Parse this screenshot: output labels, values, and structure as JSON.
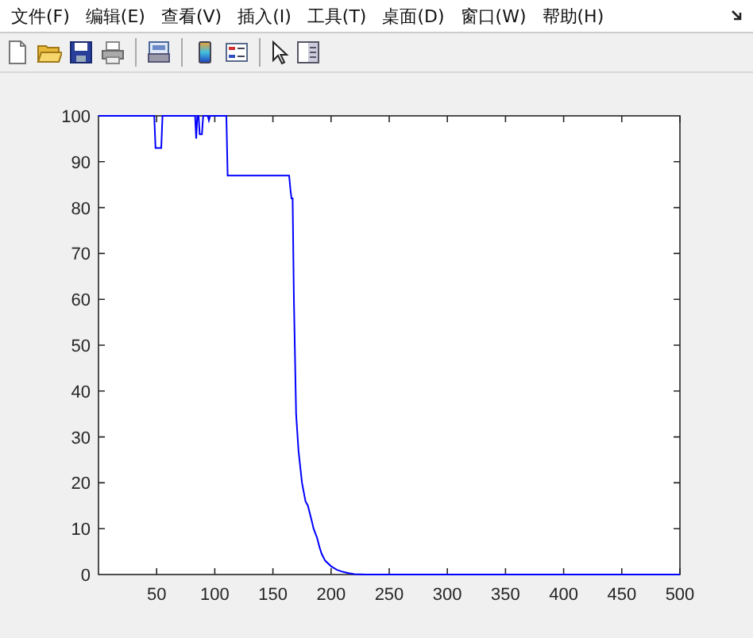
{
  "menu_bar": {
    "items": [
      "文件(F)",
      "编辑(E)",
      "查看(V)",
      "插入(I)",
      "工具(T)",
      "桌面(D)",
      "窗口(W)",
      "帮助(H)"
    ]
  },
  "figure": {
    "chart_data": {
      "type": "line",
      "x": [
        0,
        48,
        49,
        54,
        55,
        83,
        84,
        85,
        86,
        87,
        88,
        89,
        90,
        94,
        95,
        96,
        110,
        111,
        164,
        165,
        166,
        167,
        168,
        170,
        172,
        175,
        178,
        180,
        183,
        185,
        188,
        190,
        192,
        195,
        200,
        205,
        210,
        215,
        220,
        230,
        240,
        500
      ],
      "series": [
        {
          "color": "#0000ff",
          "values": [
            100,
            100,
            93,
            93,
            100,
            100,
            95,
            100,
            100,
            96,
            96,
            96,
            100,
            100,
            99,
            100,
            100,
            87,
            87,
            84,
            82,
            82,
            60,
            35,
            27,
            20,
            16,
            15,
            12,
            10,
            8,
            6,
            4.5,
            3,
            1.8,
            1,
            0.6,
            0.3,
            0.1,
            0,
            0,
            0
          ]
        }
      ],
      "xlim": [
        0,
        500
      ],
      "ylim": [
        0,
        100
      ],
      "xticks": [
        50,
        100,
        150,
        200,
        250,
        300,
        350,
        400,
        450,
        500
      ],
      "yticks": [
        0,
        10,
        20,
        30,
        40,
        50,
        60,
        70,
        80,
        90,
        100
      ]
    }
  }
}
